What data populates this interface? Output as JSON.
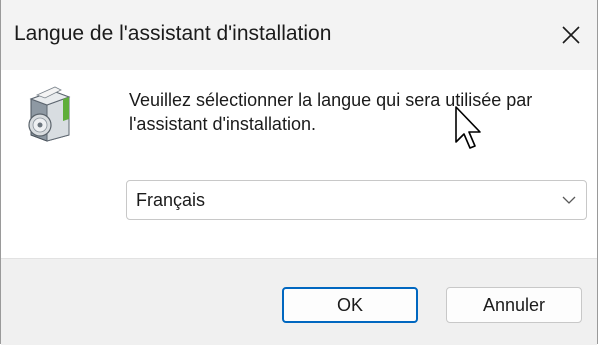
{
  "window": {
    "title": "Langue de l'assistant d'installation"
  },
  "content": {
    "message": "Veuillez sélectionner la langue qui sera utilisée par l'assistant d'installation.",
    "language_select": {
      "selected": "Français"
    }
  },
  "footer": {
    "ok_label": "OK",
    "cancel_label": "Annuler"
  },
  "icons": {
    "close": "close-icon",
    "setup": "setup-icon",
    "chevron": "chevron-down-icon",
    "cursor": "mouse-cursor-icon"
  },
  "colors": {
    "accent": "#0067c0",
    "titlebar": "#f3f3f3",
    "footer": "#f0f0f0"
  }
}
